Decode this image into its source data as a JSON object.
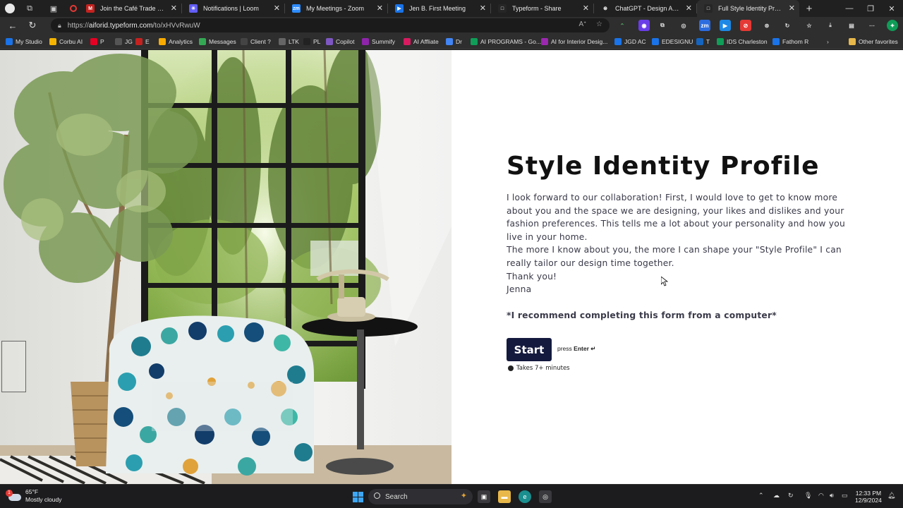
{
  "browser": {
    "tabs": [
      {
        "title": "Join the Café Trade Program",
        "favicon": "gmail-icon",
        "color": "#c5221f",
        "glyph": "M"
      },
      {
        "title": "Notifications | Loom",
        "favicon": "loom-icon",
        "color": "#625df5",
        "glyph": "✳"
      },
      {
        "title": "My Meetings - Zoom",
        "favicon": "zoom-icon",
        "color": "#2d8cff",
        "glyph": "zm"
      },
      {
        "title": "Jen B. First Meeting",
        "favicon": "bookmark-icon",
        "color": "#1a73e8",
        "glyph": "▶"
      },
      {
        "title": "Typeform - Share",
        "favicon": "typeform-icon",
        "color": "#262627",
        "glyph": "□"
      },
      {
        "title": "ChatGPT - Design Assistant",
        "favicon": "chatgpt-icon",
        "color": "#202020",
        "glyph": "⊛"
      },
      {
        "title": "Full Style Identity Profile",
        "favicon": "typeform-icon",
        "color": "#262627",
        "glyph": "□"
      }
    ],
    "active_tab_index": 6,
    "url_host": "aiforid.typeform.com",
    "url_path": "/to/xHVvRwuW",
    "url_scheme": "https://",
    "bookmarks": [
      {
        "label": "My Studio",
        "color": "#1a73e8"
      },
      {
        "label": "Corbu AI",
        "color": "#f4b400"
      },
      {
        "label": "P",
        "color": "#e60023"
      },
      {
        "label": "JG",
        "color": "#555"
      },
      {
        "label": "E",
        "color": "#c5221f"
      },
      {
        "label": "Analytics",
        "color": "#f9ab00"
      },
      {
        "label": "Messages",
        "color": "#34a853"
      },
      {
        "label": "Client ?",
        "color": "#444"
      },
      {
        "label": "LTK",
        "color": "#666"
      },
      {
        "label": "PL",
        "color": "#222"
      },
      {
        "label": "Copilot",
        "color": "#7e57c2"
      },
      {
        "label": "Summify",
        "color": "#8e24aa"
      },
      {
        "label": "AI Affliate",
        "color": "#d81b60"
      },
      {
        "label": "Dr",
        "color": "#4285f4"
      },
      {
        "label": "AI PROGRAMS - Go...",
        "color": "#0f9d58"
      },
      {
        "label": "AI for Interior Desig...",
        "color": "#9c27b0"
      },
      {
        "label": "JGD AC",
        "color": "#1a73e8"
      },
      {
        "label": "EDESIGNU",
        "color": "#1a73e8"
      },
      {
        "label": "T",
        "color": "#1565c0"
      },
      {
        "label": "IDS Charleston",
        "color": "#0f9d58"
      },
      {
        "label": "Fathom R",
        "color": "#1a73e8"
      }
    ],
    "other_favorites": "Other favorites"
  },
  "form": {
    "title": "Style Identity Profile",
    "paragraphs": [
      "I look forward to our collaboration! First, I would love to get to know more about you and the space we are designing, your likes and dislikes and your fashion preferences. This tells me a lot about your personality and how you live in your home.",
      "The more I know about you, the more I can shape your \"Style Profile\" I can really tailor our design time together.",
      "Thank you!",
      "Jenna"
    ],
    "note": "*I recommend completing this form from a computer*",
    "start_label": "Start",
    "press_label": "press",
    "press_key": "Enter ↵",
    "duration": "Takes 7+ minutes"
  },
  "taskbar": {
    "weather_temp": "65°F",
    "weather_desc": "Mostly cloudy",
    "weather_badge": "1",
    "search_label": "Search",
    "time": "12:33 PM",
    "date": "12/9/2024"
  }
}
